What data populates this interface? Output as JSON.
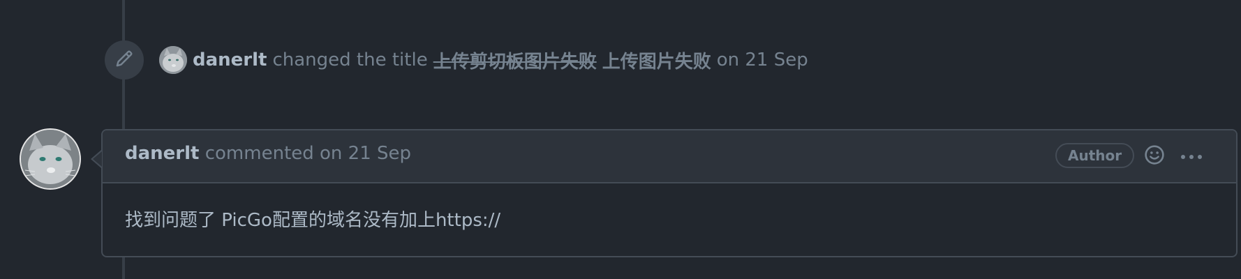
{
  "event": {
    "username": "danerlt",
    "action": "changed the title",
    "old_title": "上传剪切板图片失败",
    "new_title": "上传图片失败",
    "date": "on 21 Sep",
    "icon": "pencil-icon"
  },
  "comment": {
    "username": "danerlt",
    "action_date": "commented on 21 Sep",
    "badge": "Author",
    "body": "找到问题了 PicGo配置的域名没有加上https://",
    "reaction_icon": "smiley-icon",
    "more_icon": "kebab-horizontal-icon"
  },
  "colors": {
    "background": "#22272e",
    "header_bg": "#2d333b",
    "border": "#444c56",
    "text": "#adbac7",
    "muted": "#768390"
  }
}
